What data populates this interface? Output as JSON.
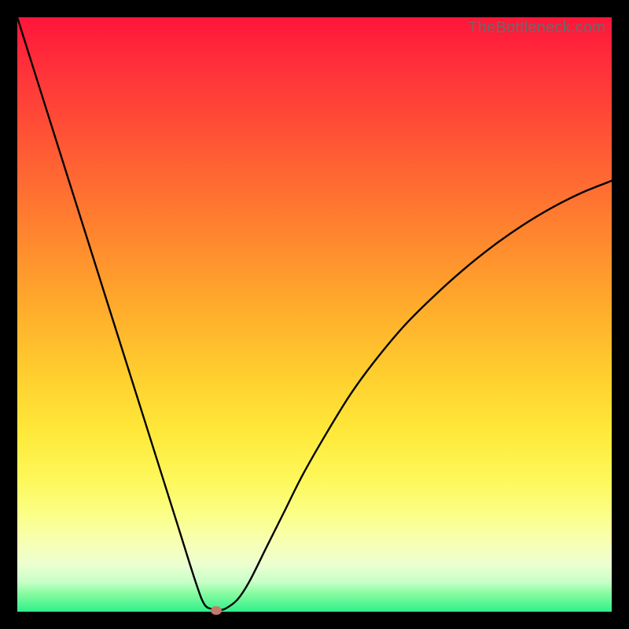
{
  "attribution": "TheBottleneck.com",
  "colors": {
    "frame": "#000000",
    "curve": "#000000",
    "marker": "#c5786c",
    "gradient_top": "#ff153a",
    "gradient_bottom": "#2ef08a"
  },
  "chart_data": {
    "type": "line",
    "title": "",
    "xlabel": "",
    "ylabel": "",
    "xlim": [
      0,
      100
    ],
    "ylim": [
      0,
      100
    ],
    "x": [
      0,
      3,
      6,
      9,
      12,
      15,
      18,
      21,
      24,
      27,
      30,
      31.5,
      33,
      34,
      35,
      37,
      39,
      42,
      45,
      48,
      52,
      56,
      60,
      65,
      70,
      75,
      80,
      85,
      90,
      95,
      100
    ],
    "values": [
      100,
      90.5,
      81,
      71.5,
      62,
      52.5,
      43,
      33.5,
      24,
      14.5,
      5,
      1.2,
      0.4,
      0.3,
      0.5,
      2.0,
      5.0,
      11,
      17,
      23,
      30,
      36.5,
      42,
      48,
      53,
      57.5,
      61.5,
      65,
      68,
      70.5,
      72.5
    ],
    "marker": {
      "x": 33.5,
      "y": 0.3
    }
  }
}
